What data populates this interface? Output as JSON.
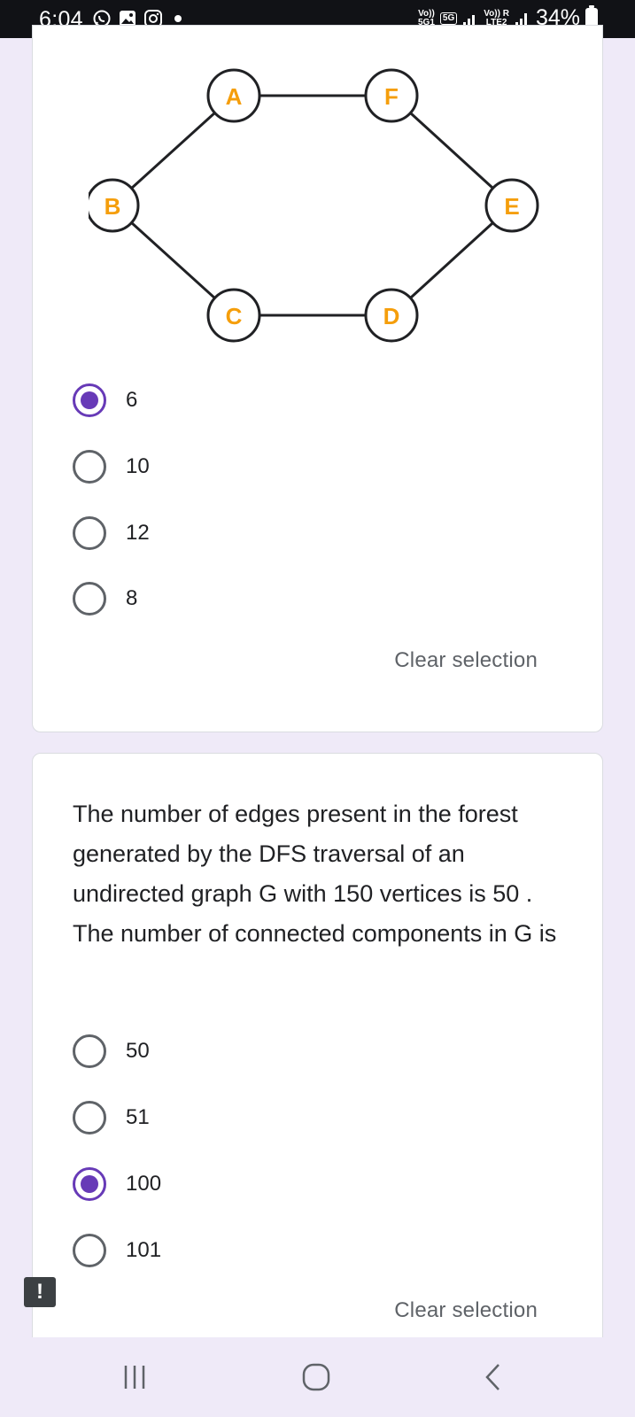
{
  "status_bar": {
    "time": "6:04",
    "left_icons": [
      "whatsapp-icon",
      "gallery-icon",
      "instagram-icon",
      "notification-dot"
    ],
    "sim1_label_top": "Vo))",
    "sim1_label_bottom": "5G1",
    "network_badge": "5G",
    "sim2_label_top": "Vo)) R",
    "sim2_label_bottom": "LTE2",
    "battery": "34%"
  },
  "question1": {
    "graph": {
      "nodes": [
        "A",
        "F",
        "B",
        "E",
        "C",
        "D"
      ],
      "edges": [
        [
          "A",
          "F"
        ],
        [
          "A",
          "B"
        ],
        [
          "F",
          "E"
        ],
        [
          "B",
          "C"
        ],
        [
          "E",
          "D"
        ],
        [
          "C",
          "D"
        ]
      ],
      "node_label_color": "#f59e0b"
    },
    "options": [
      {
        "label": "6",
        "selected": true
      },
      {
        "label": "10",
        "selected": false
      },
      {
        "label": "12",
        "selected": false
      },
      {
        "label": "8",
        "selected": false
      }
    ],
    "clear_label": "Clear selection"
  },
  "question2": {
    "text": "The number of edges present in the forest generated by the DFS traversal of an undirected graph G with 150 vertices is 50 . The number of connected components in G is",
    "options": [
      {
        "label": "50",
        "selected": false
      },
      {
        "label": "51",
        "selected": false
      },
      {
        "label": "100",
        "selected": true
      },
      {
        "label": "101",
        "selected": false
      }
    ],
    "clear_label": "Clear selection"
  },
  "alert_icon": "!",
  "colors": {
    "accent": "#673ab7",
    "background": "#efeaf8",
    "status_bar": "#111216"
  },
  "nav_bar": [
    "recents-icon",
    "home-icon",
    "back-icon"
  ]
}
